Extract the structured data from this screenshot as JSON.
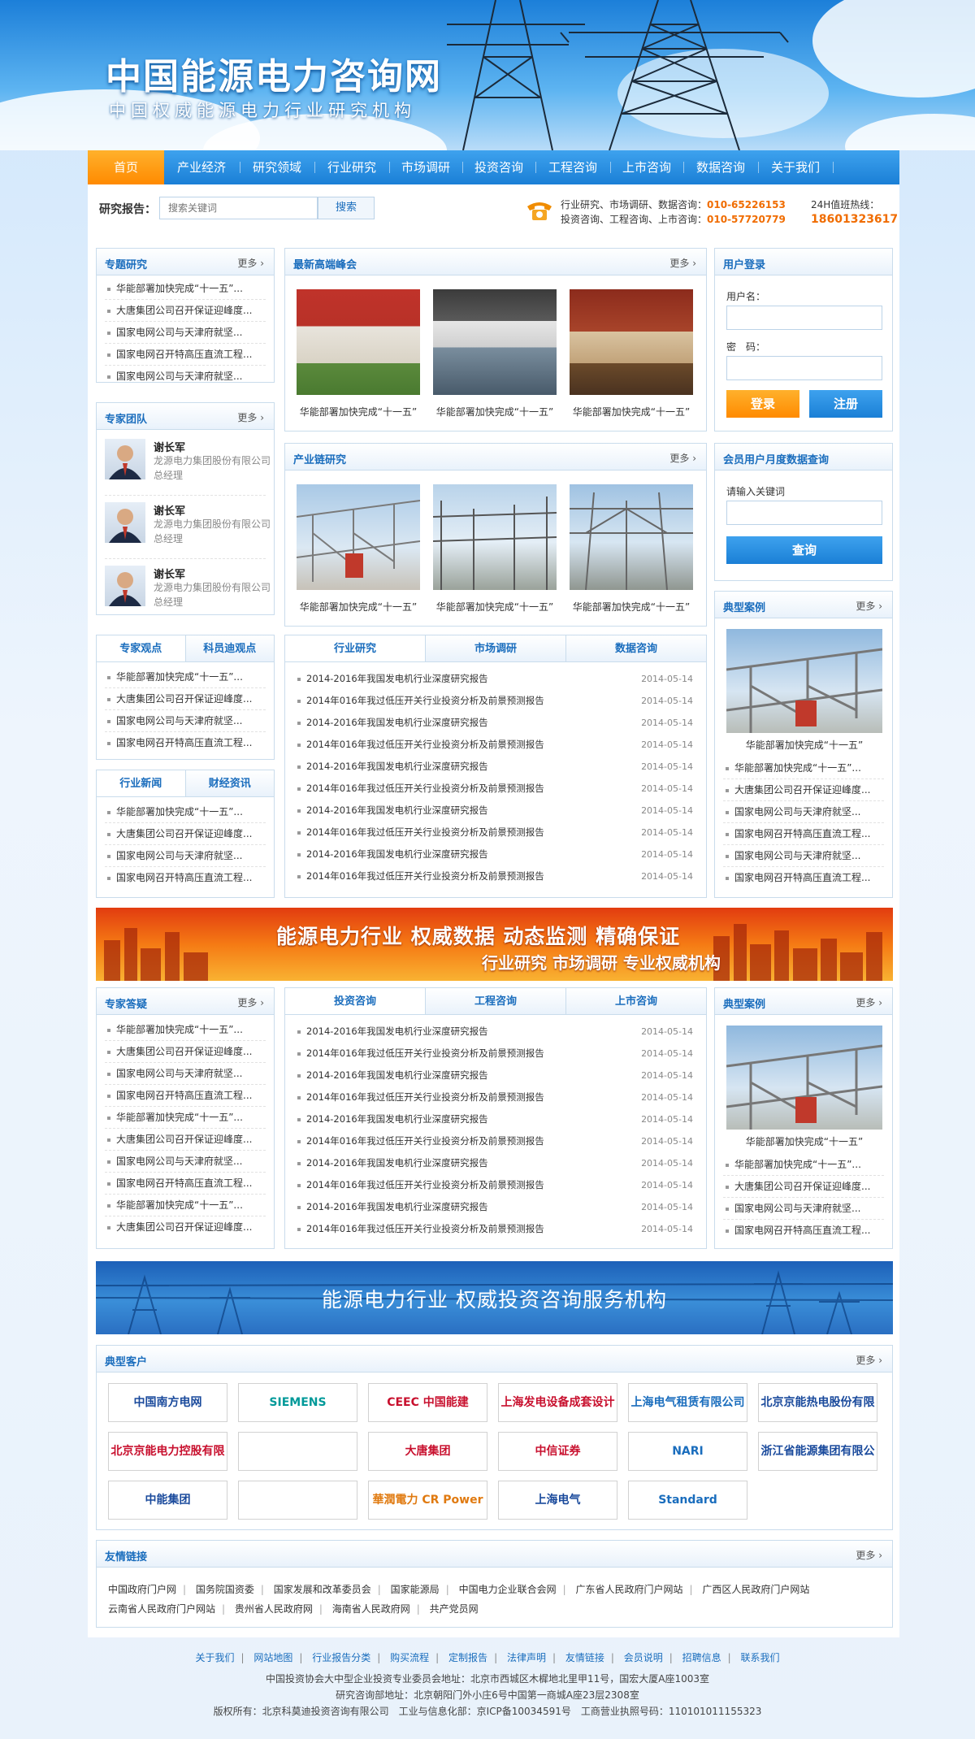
{
  "site": {
    "title": "中国能源电力咨询网",
    "subtitle": "中国权威能源电力行业研究机构"
  },
  "nav": [
    "首页",
    "产业经济",
    "研究领域",
    "行业研究",
    "市场调研",
    "投资咨询",
    "工程咨询",
    "上市咨询",
    "数据咨询",
    "关于我们"
  ],
  "search": {
    "label": "研究报告：",
    "placeholder": "搜索关键词",
    "button": "搜索"
  },
  "contact": {
    "line1": "行业研究、市场调研、数据咨询：",
    "phone1": "010-65226153",
    "line2": "投资咨询、工程咨询、上市咨询：",
    "phone2": "010-57720779",
    "hotline_label": "24H值班热线：",
    "hotline": "18601323617"
  },
  "more": "更多",
  "special": {
    "title": "专题研究",
    "items": [
      "华能部署加快完成“十一五”...",
      "大唐集团公司召开保证迎峰度...",
      "国家电网公司与天津府就坚...",
      "国家电网召开特高压直流工程...",
      "国家电网公司与天津府就坚..."
    ]
  },
  "summit": {
    "title": "最新高端峰会",
    "captions": [
      "华能部署加快完成“十一五”",
      "华能部署加快完成“十一五”",
      "华能部署加快完成“十一五”"
    ]
  },
  "login": {
    "title": "用户登录",
    "username": "用户名：",
    "password": "密　码：",
    "login": "登录",
    "register": "注册"
  },
  "team": {
    "title": "专家团队",
    "experts": [
      {
        "name": "谢长军",
        "desc": "龙源电力集团股份有限公司总经理"
      },
      {
        "name": "谢长军",
        "desc": "龙源电力集团股份有限公司总经理"
      },
      {
        "name": "谢长军",
        "desc": "龙源电力集团股份有限公司总经理"
      }
    ]
  },
  "chain": {
    "title": "产业链研究",
    "captions": [
      "华能部署加快完成“十一五”",
      "华能部署加快完成“十一五”",
      "华能部署加快完成“十一五”"
    ]
  },
  "query": {
    "title": "会员用户月度数据查询",
    "label": "请输入关键词",
    "button": "查询"
  },
  "cases": {
    "title": "典型案例",
    "caption": "华能部署加快完成“十一五”",
    "items": [
      "华能部署加快完成“十一五”...",
      "大唐集团公司召开保证迎峰度...",
      "国家电网公司与天津府就坚...",
      "国家电网召开特高压直流工程...",
      "国家电网公司与天津府就坚...",
      "国家电网召开特高压直流工程..."
    ]
  },
  "views": {
    "tabs": [
      "专家观点",
      "科员迪观点"
    ],
    "items": [
      "华能部署加快完成“十一五”...",
      "大唐集团公司召开保证迎峰度...",
      "国家电网公司与天津府就坚...",
      "国家电网召开特高压直流工程..."
    ]
  },
  "news": {
    "tabs": [
      "行业新闻",
      "财经资讯"
    ],
    "items": [
      "华能部署加快完成“十一五”...",
      "大唐集团公司召开保证迎峰度...",
      "国家电网公司与天津府就坚...",
      "国家电网召开特高压直流工程..."
    ]
  },
  "research": {
    "tabs": [
      "行业研究",
      "市场调研",
      "数据咨询"
    ],
    "items": [
      {
        "t": "2014-2016年我国发电机行业深度研究报告",
        "d": "2014-05-14"
      },
      {
        "t": "2014年016年我过低压开关行业投资分析及前景预测报告",
        "d": "2014-05-14"
      },
      {
        "t": "2014-2016年我国发电机行业深度研究报告",
        "d": "2014-05-14"
      },
      {
        "t": "2014年016年我过低压开关行业投资分析及前景预测报告",
        "d": "2014-05-14"
      },
      {
        "t": "2014-2016年我国发电机行业深度研究报告",
        "d": "2014-05-14"
      },
      {
        "t": "2014年016年我过低压开关行业投资分析及前景预测报告",
        "d": "2014-05-14"
      },
      {
        "t": "2014-2016年我国发电机行业深度研究报告",
        "d": "2014-05-14"
      },
      {
        "t": "2014年016年我过低压开关行业投资分析及前景预测报告",
        "d": "2014-05-14"
      },
      {
        "t": "2014-2016年我国发电机行业深度研究报告",
        "d": "2014-05-14"
      },
      {
        "t": "2014年016年我过低压开关行业投资分析及前景预测报告",
        "d": "2014-05-14"
      }
    ]
  },
  "banner1": {
    "line1": "能源电力行业 权威数据 动态监测 精确保证",
    "line2": "行业研究 市场调研 专业权威机构"
  },
  "qa": {
    "title": "专家答疑",
    "items": [
      "华能部署加快完成“十一五”...",
      "大唐集团公司召开保证迎峰度...",
      "国家电网公司与天津府就坚...",
      "国家电网召开特高压直流工程...",
      "华能部署加快完成“十一五”...",
      "大唐集团公司召开保证迎峰度...",
      "国家电网公司与天津府就坚...",
      "国家电网召开特高压直流工程...",
      "华能部署加快完成“十一五”...",
      "大唐集团公司召开保证迎峰度..."
    ]
  },
  "invest": {
    "tabs": [
      "投资咨询",
      "工程咨询",
      "上市咨询"
    ],
    "items": [
      {
        "t": "2014-2016年我国发电机行业深度研究报告",
        "d": "2014-05-14"
      },
      {
        "t": "2014年016年我过低压开关行业投资分析及前景预测报告",
        "d": "2014-05-14"
      },
      {
        "t": "2014-2016年我国发电机行业深度研究报告",
        "d": "2014-05-14"
      },
      {
        "t": "2014年016年我过低压开关行业投资分析及前景预测报告",
        "d": "2014-05-14"
      },
      {
        "t": "2014-2016年我国发电机行业深度研究报告",
        "d": "2014-05-14"
      },
      {
        "t": "2014年016年我过低压开关行业投资分析及前景预测报告",
        "d": "2014-05-14"
      },
      {
        "t": "2014-2016年我国发电机行业深度研究报告",
        "d": "2014-05-14"
      },
      {
        "t": "2014年016年我过低压开关行业投资分析及前景预测报告",
        "d": "2014-05-14"
      },
      {
        "t": "2014-2016年我国发电机行业深度研究报告",
        "d": "2014-05-14"
      },
      {
        "t": "2014年016年我过低压开关行业投资分析及前景预测报告",
        "d": "2014-05-14"
      }
    ]
  },
  "cases2": {
    "title": "典型案例",
    "caption": "华能部署加快完成“十一五”",
    "items": [
      "华能部署加快完成“十一五”...",
      "大唐集团公司召开保证迎峰度...",
      "国家电网公司与天津府就坚...",
      "国家电网召开特高压直流工程..."
    ]
  },
  "banner2": {
    "text": "能源电力行业  权威投资咨询服务机构"
  },
  "clients": {
    "title": "典型客户",
    "logos": [
      {
        "text": "中国南方电网",
        "color": "#1a4a9c"
      },
      {
        "text": "SIEMENS",
        "color": "#009999"
      },
      {
        "text": "CEEC 中国能建",
        "color": "#c8102e"
      },
      {
        "text": "上海发电设备成套设计研究院",
        "color": "#c8102e"
      },
      {
        "text": "上海电气租赁有限公司",
        "color": "#1a6dbd"
      },
      {
        "text": "北京京能热电股份有限公司",
        "color": "#1a4a9c"
      },
      {
        "text": "北京京能电力控股有限责任公司",
        "color": "#c8102e"
      },
      {
        "text": "",
        "color": "#1a7a4a"
      },
      {
        "text": "大唐集团",
        "color": "#c8102e"
      },
      {
        "text": "中信证券",
        "color": "#c8102e"
      },
      {
        "text": "NARI",
        "color": "#1a6dbd"
      },
      {
        "text": "浙江省能源集团有限公司",
        "color": "#1a4a9c"
      },
      {
        "text": "中能集团",
        "color": "#1a4a9c"
      },
      {
        "text": "",
        "color": "#c8102e"
      },
      {
        "text": "華潤電力 CR Power",
        "color": "#e07a10"
      },
      {
        "text": "上海电气",
        "color": "#1a4a9c"
      },
      {
        "text": "Standard Chartered 渣打银行",
        "color": "#1a6dbd"
      }
    ]
  },
  "links": {
    "title": "友情链接",
    "items": [
      "中国政府门户网",
      "国务院国资委",
      "国家发展和改革委员会",
      "国家能源局",
      "中国电力企业联合会网",
      "广东省人民政府门户网站",
      "广西区人民政府门户网站",
      "云南省人民政府门户网站",
      "贵州省人民政府网",
      "海南省人民政府网",
      "共产党员网"
    ]
  },
  "footer": {
    "nav": [
      "关于我们",
      "网站地图",
      "行业报告分类",
      "购买流程",
      "定制报告",
      "法律声明",
      "友情链接",
      "会员说明",
      "招聘信息",
      "联系我们"
    ],
    "line1": "中国投资协会大中型企业投资专业委员会地址：北京市西城区木樨地北里甲11号，国宏大厦A座1003室",
    "line2": "研究咨询部地址：北京朝阳门外小庄6号中国第一商城A座23层2308室",
    "line3": "版权所有：北京科莫迪投资咨询有限公司　工业与信息化部：京ICP备10034591号　工商营业执照号码：110101011155323"
  }
}
